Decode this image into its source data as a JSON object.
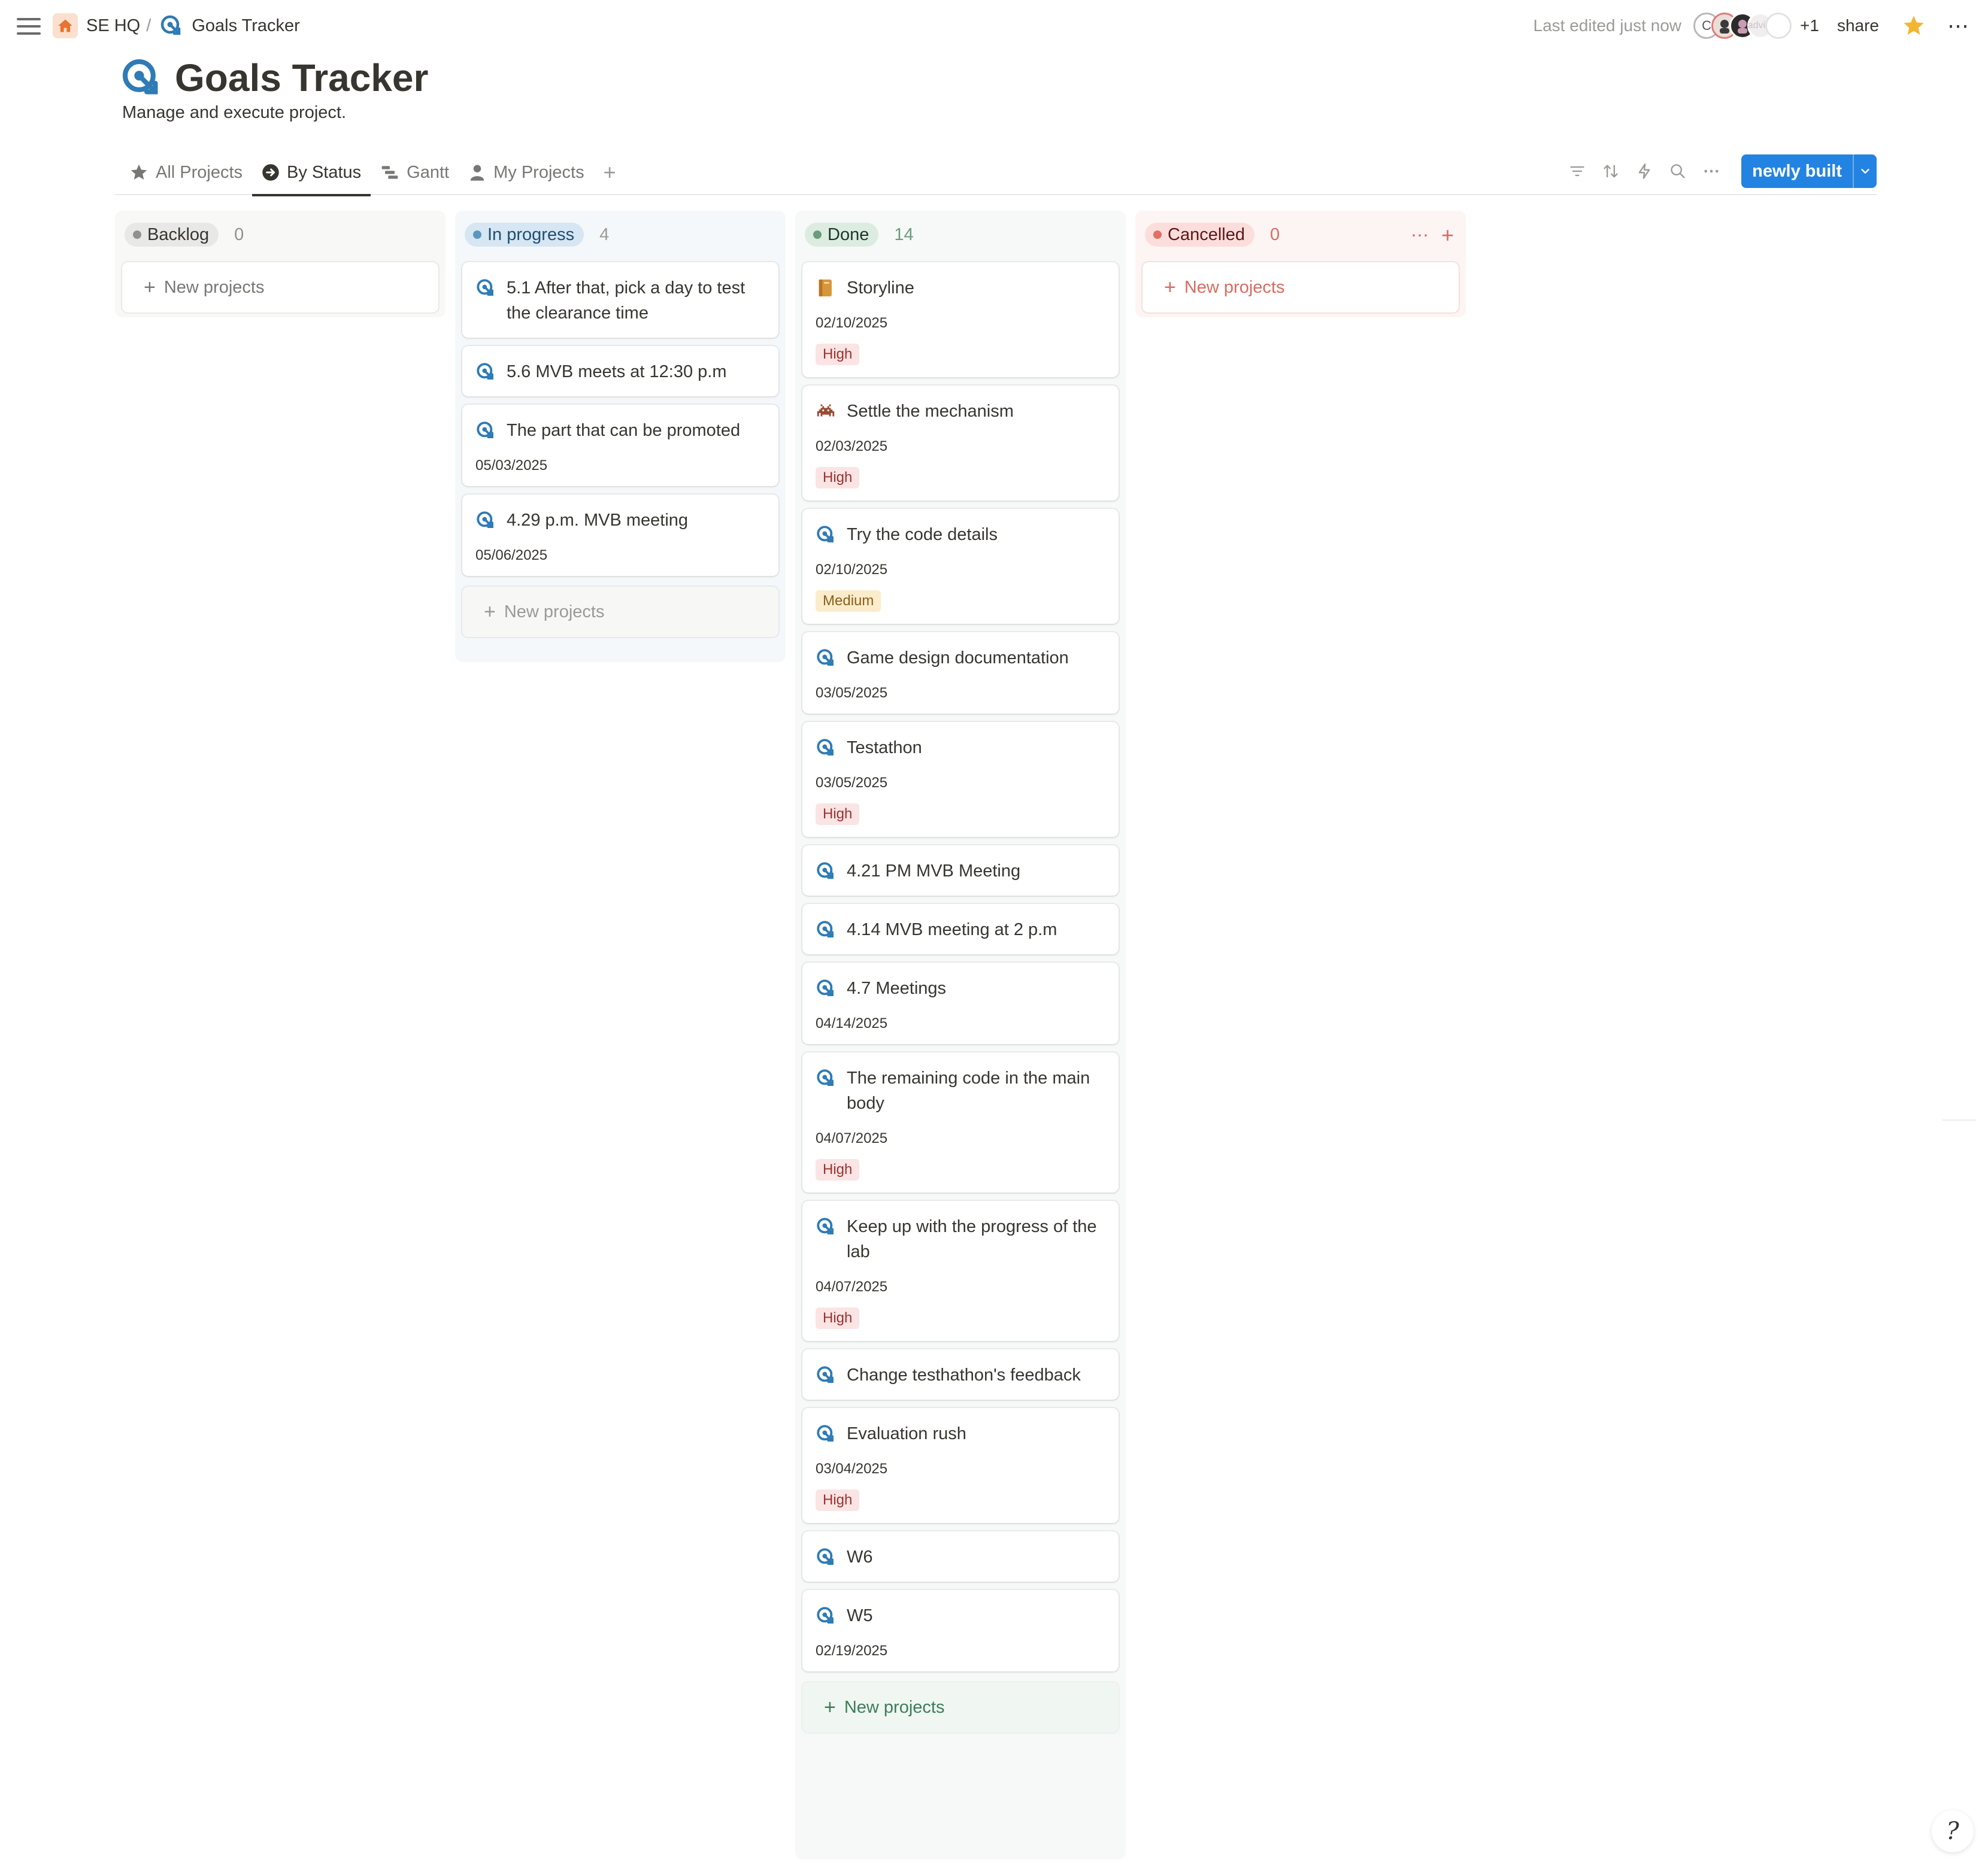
{
  "topbar": {
    "breadcrumbs": [
      "SE HQ",
      "Goals Tracker"
    ],
    "separator": "/",
    "last_edited": "Last edited just now",
    "avatar_initial": "C",
    "avatar_faded_text": "advith",
    "extra_count": "+1",
    "share_label": "share",
    "more_label": "⋯"
  },
  "page": {
    "title": "Goals Tracker",
    "description": "Manage and execute project."
  },
  "views": {
    "tabs": [
      {
        "label": "All Projects",
        "icon": "star-icon"
      },
      {
        "label": "By Status",
        "icon": "arrow-circle-icon",
        "active": true
      },
      {
        "label": "Gantt",
        "icon": "gantt-icon"
      },
      {
        "label": "My Projects",
        "icon": "person-icon"
      }
    ],
    "add_label": "+",
    "tools": [
      "filter-icon",
      "sort-icon",
      "automation-icon",
      "search-icon",
      "more-icon"
    ],
    "new_button_label": "newly built"
  },
  "columns": {
    "backlog": {
      "label": "Backlog",
      "count": "0",
      "color": "#91918e",
      "new_label": "New projects"
    },
    "inprogress": {
      "label": "In progress",
      "count": "4",
      "color": "#5b97bd",
      "new_label": "New projects"
    },
    "done": {
      "label": "Done",
      "count": "14",
      "color": "#6c9b7d",
      "new_label": "New projects"
    },
    "cancelled": {
      "label": "Cancelled",
      "count": "0",
      "color": "#e16f64",
      "new_label": "New projects"
    }
  },
  "inprogress_cards": [
    {
      "title": "5.1 After that, pick a day to test the clearance time",
      "date": "",
      "priority": ""
    },
    {
      "title": "5.6 MVB meets at 12:30 p.m",
      "date": "",
      "priority": ""
    },
    {
      "title": "The part that can be promoted",
      "date": "05/03/2025",
      "priority": ""
    },
    {
      "title": "4.29 p.m. MVB meeting",
      "date": "05/06/2025",
      "priority": ""
    }
  ],
  "done_cards": [
    {
      "title": "Storyline",
      "date": "02/10/2025",
      "priority": "High",
      "icon": "book-icon"
    },
    {
      "title": "Settle the mechanism",
      "date": "02/03/2025",
      "priority": "High",
      "icon": "invader-icon"
    },
    {
      "title": "Try the code details",
      "date": "02/10/2025",
      "priority": "Medium",
      "icon": "goal-icon"
    },
    {
      "title": "Game design documentation",
      "date": "03/05/2025",
      "priority": "",
      "icon": "goal-icon"
    },
    {
      "title": "Testathon",
      "date": "03/05/2025",
      "priority": "High",
      "icon": "goal-icon"
    },
    {
      "title": "4.21 PM MVB Meeting",
      "date": "",
      "priority": "",
      "icon": "goal-icon"
    },
    {
      "title": "4.14 MVB meeting at 2 p.m",
      "date": "",
      "priority": "",
      "icon": "goal-icon"
    },
    {
      "title": "4.7 Meetings",
      "date": "04/14/2025",
      "priority": "",
      "icon": "goal-icon"
    },
    {
      "title": "The remaining code in the main body",
      "date": "04/07/2025",
      "priority": "High",
      "icon": "goal-icon"
    },
    {
      "title": "Keep up with the progress of the lab",
      "date": "04/07/2025",
      "priority": "High",
      "icon": "goal-icon"
    },
    {
      "title": "Change testhathon's feedback",
      "date": "",
      "priority": "",
      "icon": "goal-icon"
    },
    {
      "title": "Evaluation rush",
      "date": "03/04/2025",
      "priority": "High",
      "icon": "goal-icon"
    },
    {
      "title": "W6",
      "date": "",
      "priority": "",
      "icon": "goal-icon"
    },
    {
      "title": "W5",
      "date": "02/19/2025",
      "priority": "",
      "icon": "goal-icon"
    }
  ],
  "colors": {
    "accent": "#2383e2",
    "goal_icon": "#2e7bb5",
    "high_bg": "#fbe4e4",
    "medium_bg": "#fbeccb"
  }
}
